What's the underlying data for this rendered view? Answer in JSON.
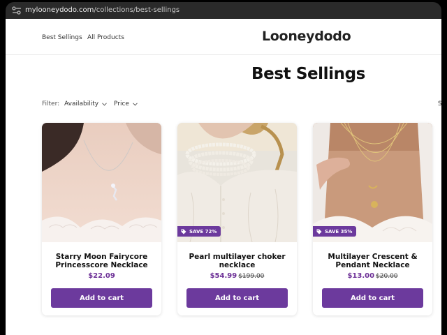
{
  "browser": {
    "url_host": "mylooneydodo.com",
    "url_path": "/collections/best-sellings"
  },
  "header": {
    "nav": [
      "Best Sellings",
      "All Products"
    ],
    "logo": "Looneydodo"
  },
  "collection": {
    "title": "Best Sellings",
    "filter_label": "Filter:",
    "filters": [
      "Availability",
      "Price"
    ],
    "sort_label_visible": "So"
  },
  "products": [
    {
      "name": "Starry Moon Fairycore Princesscore Necklace",
      "price": "$22.09",
      "compare_price": "",
      "badge": "",
      "button": "Add to cart"
    },
    {
      "name": "Pearl multilayer choker necklace",
      "price": "$54.99",
      "compare_price": "$199.00",
      "badge": "SAVE 72%",
      "button": "Add to cart"
    },
    {
      "name": "Multilayer Crescent & Pendant Necklace",
      "price": "$13.00",
      "compare_price": "$20.00",
      "badge": "SAVE 35%",
      "button": "Add to cart"
    }
  ],
  "colors": {
    "accent": "#6c3a9d",
    "price": "#6c2f96",
    "browser_bar": "#2a2a2a"
  }
}
